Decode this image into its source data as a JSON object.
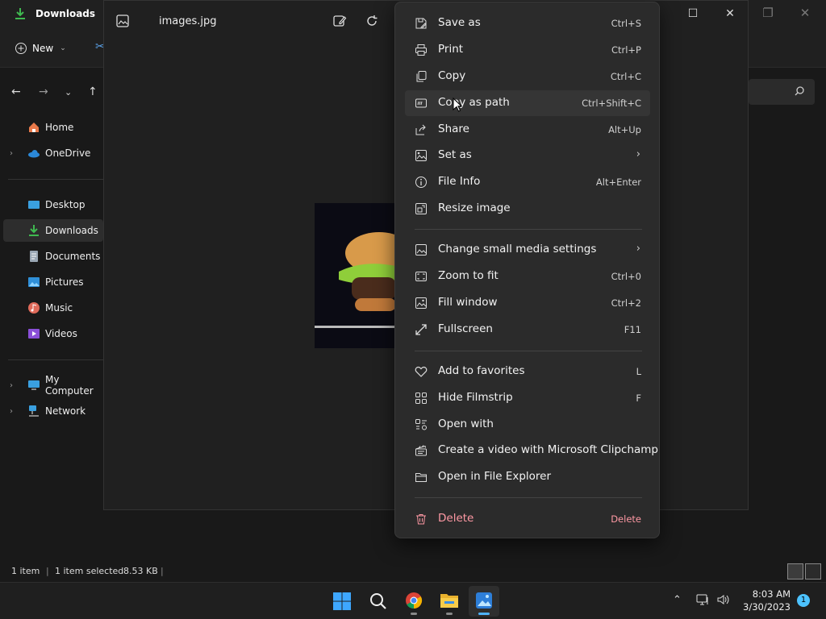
{
  "explorer": {
    "tab_title": "Downloads",
    "new_label": "New",
    "sidebar": {
      "home": "Home",
      "onedrive": "OneDrive",
      "desktop": "Desktop",
      "downloads": "Downloads",
      "documents": "Documents",
      "pictures": "Pictures",
      "music": "Music",
      "videos": "Videos",
      "my_computer": "My Computer",
      "network": "Network"
    },
    "status": {
      "item_count": "1 item",
      "selected": "1 item selected",
      "size": "8.53 KB"
    }
  },
  "viewer": {
    "file_name": "images.jpg"
  },
  "menu": {
    "save_as": {
      "label": "Save as",
      "shortcut": "Ctrl+S"
    },
    "print": {
      "label": "Print",
      "shortcut": "Ctrl+P"
    },
    "copy": {
      "label": "Copy",
      "shortcut": "Ctrl+C"
    },
    "copy_path": {
      "label": "Copy as path",
      "shortcut": "Ctrl+Shift+C"
    },
    "share": {
      "label": "Share",
      "shortcut": "Alt+Up"
    },
    "set_as": {
      "label": "Set as"
    },
    "file_info": {
      "label": "File Info",
      "shortcut": "Alt+Enter"
    },
    "resize": {
      "label": "Resize image"
    },
    "small_media": {
      "label": "Change small media settings"
    },
    "zoom_fit": {
      "label": "Zoom to fit",
      "shortcut": "Ctrl+0"
    },
    "fill_window": {
      "label": "Fill window",
      "shortcut": "Ctrl+2"
    },
    "fullscreen": {
      "label": "Fullscreen",
      "shortcut": "F11"
    },
    "favorites": {
      "label": "Add to favorites",
      "shortcut": "L"
    },
    "filmstrip": {
      "label": "Hide Filmstrip",
      "shortcut": "F"
    },
    "open_with": {
      "label": "Open with"
    },
    "clipchamp": {
      "label": "Create a video with Microsoft Clipchamp"
    },
    "file_explorer": {
      "label": "Open in File Explorer"
    },
    "delete": {
      "label": "Delete",
      "shortcut": "Delete"
    }
  },
  "taskbar": {
    "time": "8:03 AM",
    "date": "3/30/2023",
    "notifications": "1"
  },
  "colors": {
    "accent": "#4cc2ff",
    "danger": "#ff99a4",
    "menu_bg": "#2b2b2b"
  }
}
